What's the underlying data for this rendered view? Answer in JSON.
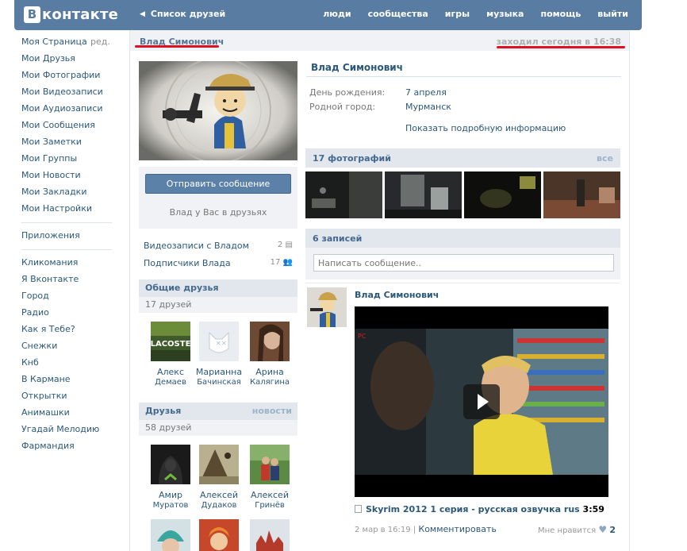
{
  "header": {
    "logo_letter": "В",
    "logo_text": "контакте",
    "back_label": "Список друзей",
    "nav": [
      "люди",
      "сообщества",
      "игры",
      "музыка",
      "помощь",
      "выйти"
    ]
  },
  "sidebar": {
    "edit_label": "ред.",
    "group1": [
      "Моя Страница",
      "Мои Друзья",
      "Мои Фотографии",
      "Мои Видеозаписи",
      "Мои Аудиозаписи",
      "Мои Сообщения",
      "Мои Заметки",
      "Мои Группы",
      "Мои Новости",
      "Мои Закладки",
      "Мои Настройки"
    ],
    "group2": [
      "Приложения"
    ],
    "group3": [
      "Кликомания",
      "Я Вконтакте",
      "Город",
      "Радио",
      "Как я Тебе?",
      "Снежки",
      "Кнб",
      "В Кармане",
      "Открытки",
      "Анимашки",
      "Угадай Мелодию",
      "Фармандия"
    ]
  },
  "profile": {
    "page_name": "Влад Симонович",
    "last_seen": "заходил сегодня в 16:38",
    "send_message": "Отправить сообщение",
    "friend_status": "Влад у Вас в друзьях",
    "videos_link": "Видеозаписи с Владом",
    "videos_count": "2",
    "subscribers_link": "Подписчики Влада",
    "subscribers_count": "17",
    "colors": {
      "accent": "#587ca2",
      "link": "#2b587a",
      "highlight": "#dd1122"
    }
  },
  "common_friends": {
    "title": "Общие друзья",
    "count": "17 друзей",
    "items": [
      {
        "first": "Алекс",
        "last": "Демаев"
      },
      {
        "first": "Марианна",
        "last": "Бачинская"
      },
      {
        "first": "Арина",
        "last": "Калягина"
      }
    ]
  },
  "friends": {
    "title": "Друзья",
    "more": "новости",
    "count": "58 друзей",
    "items": [
      {
        "first": "Амир",
        "last": "Муратов"
      },
      {
        "first": "Алексей",
        "last": "Дудаков"
      },
      {
        "first": "Алексей",
        "last": "Гринёв"
      }
    ]
  },
  "info": {
    "name": "Влад Симонович",
    "birthday_label": "День рождения:",
    "birthday": "7 апреля",
    "city_label": "Родной город:",
    "city": "Мурманск",
    "show_more": "Показать подробную информацию"
  },
  "photos": {
    "title": "17 фотографий",
    "more": "все"
  },
  "wall": {
    "title": "6 записей",
    "placeholder": "Написать сообщение.."
  },
  "post": {
    "author": "Влад Симонович",
    "video_title": "Skyrim 2012 1 серия - русская озвучка rus",
    "video_duration": "3:59",
    "date": "2 мар в 16:19",
    "separator": "|",
    "comment_label": "Комментировать",
    "like_label": "Мне нравится",
    "like_count": "2",
    "logo_text": "LACOSTE"
  }
}
